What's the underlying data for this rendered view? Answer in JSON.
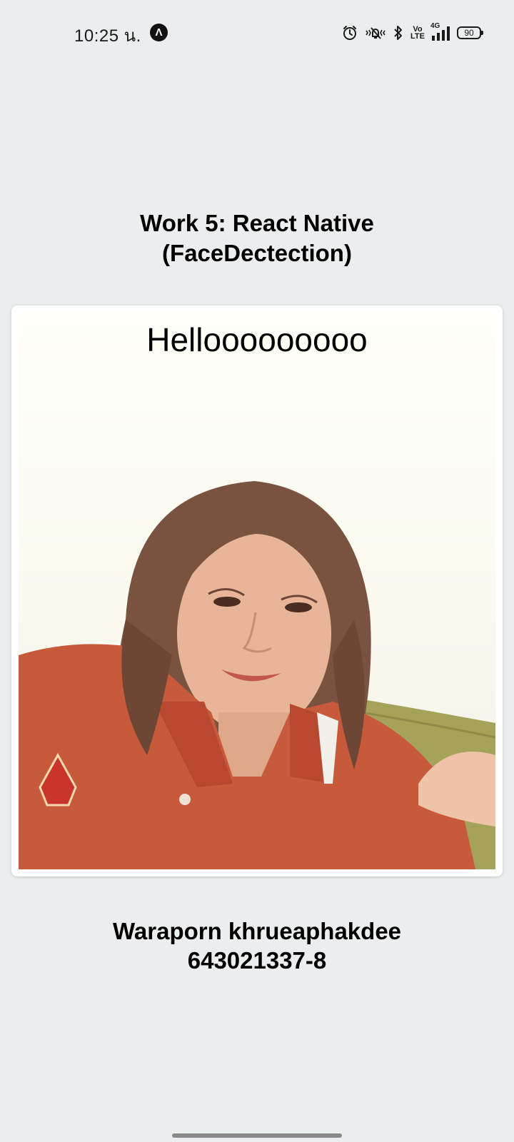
{
  "status_bar": {
    "time": "10:25 น.",
    "app_badge": "Λ",
    "volte": [
      "Vo",
      "LTE"
    ],
    "network": "4G",
    "battery": "90",
    "icons": [
      "alarm-icon",
      "vibrate-icon",
      "bluetooth-icon",
      "volte-icon",
      "signal-icon",
      "battery-icon"
    ]
  },
  "title": {
    "line1": "Work 5: React Native",
    "line2": "(FaceDectection)"
  },
  "card": {
    "overlay_text": "Hellooooooooo"
  },
  "footer": {
    "name": "Waraporn khrueaphakdee",
    "student_id": "643021337-8"
  }
}
